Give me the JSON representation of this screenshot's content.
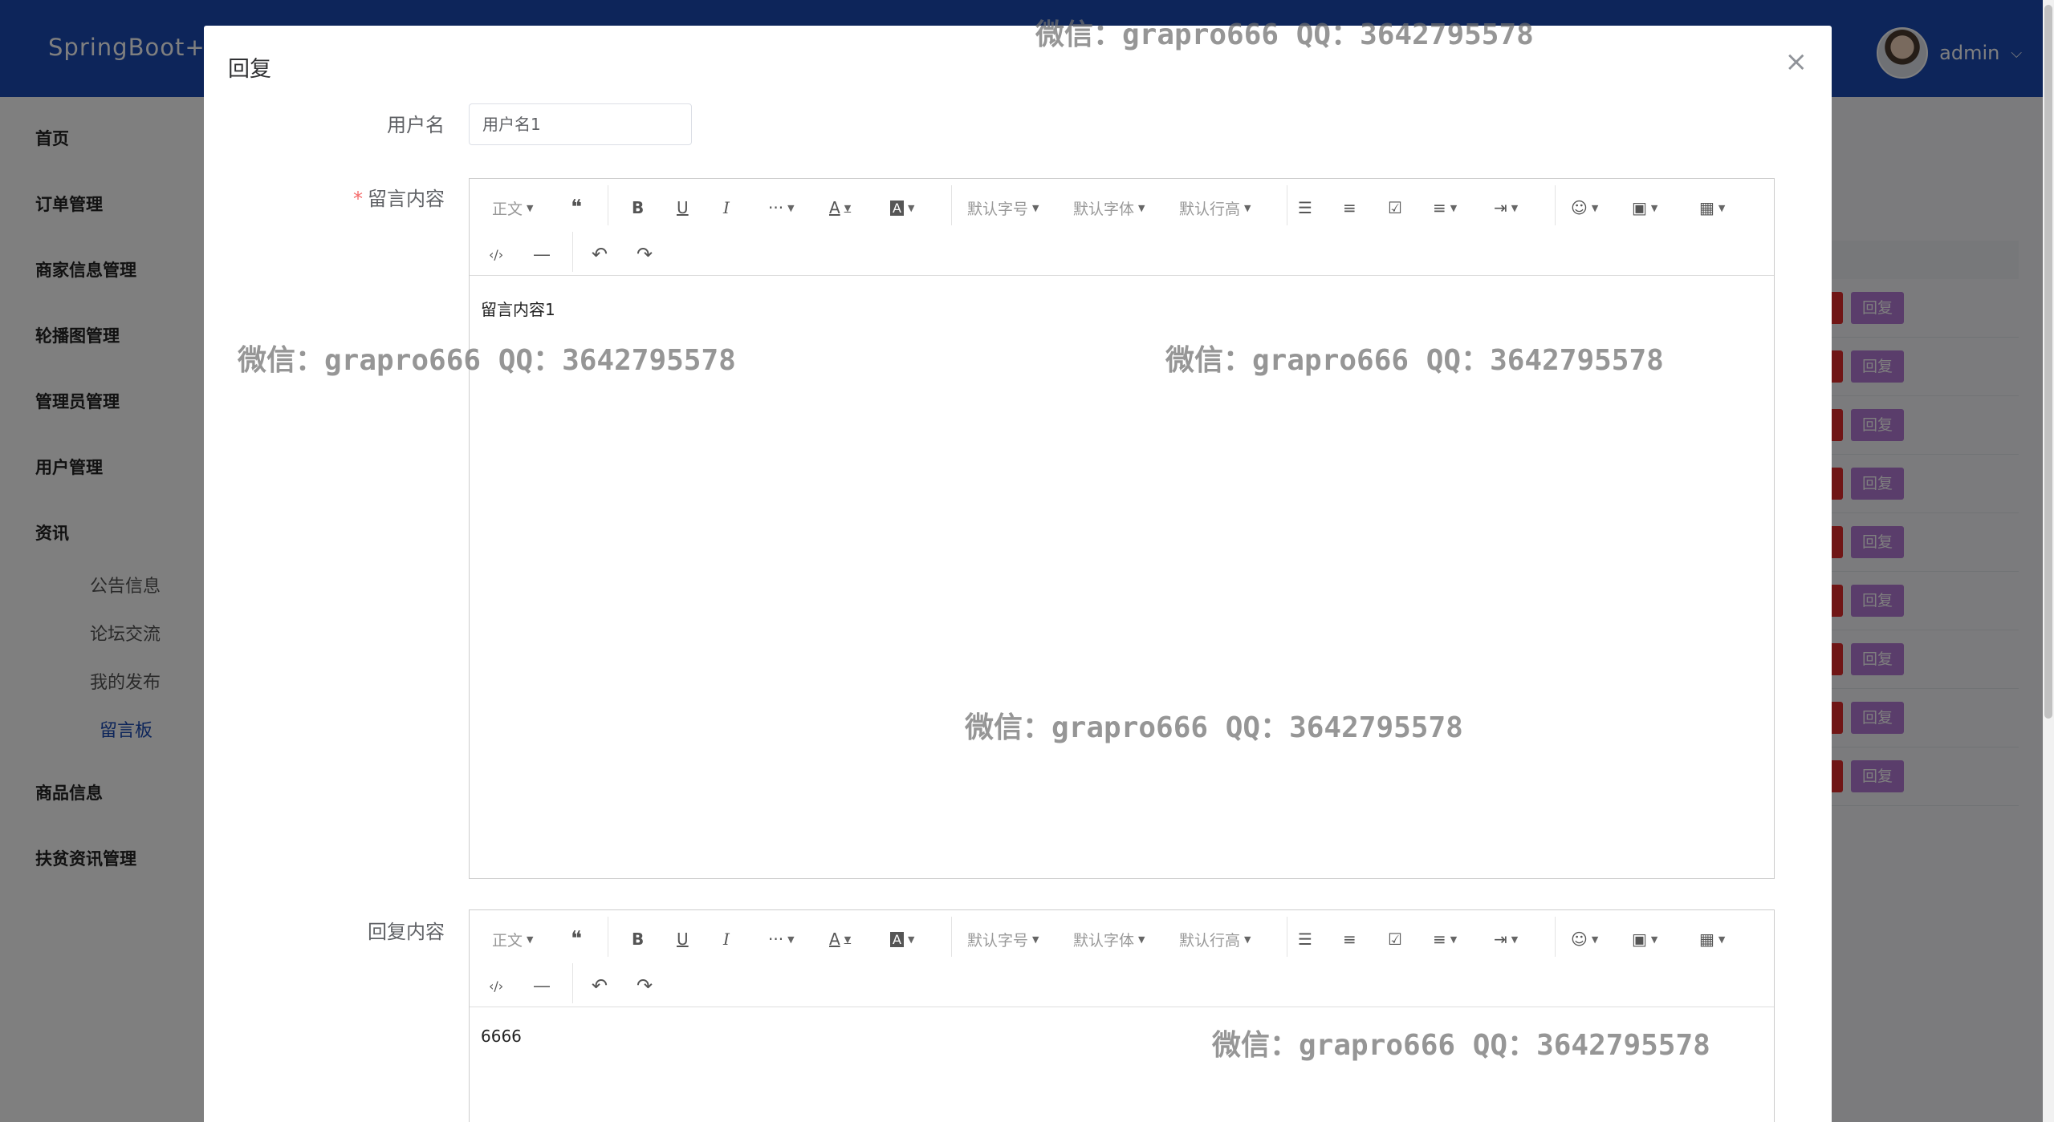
{
  "app": {
    "brand": "SpringBoot+V",
    "user": "admin"
  },
  "sidebar": {
    "items": [
      "首页",
      "订单管理",
      "商家信息管理",
      "轮播图管理",
      "管理员管理",
      "用户管理",
      "资讯",
      "商品信息",
      "扶贫资讯管理"
    ],
    "sub_items": [
      "公告信息",
      "论坛交流",
      "我的发布",
      "留言板"
    ]
  },
  "table": {
    "reply_label": "回复"
  },
  "dialog": {
    "title": "回复",
    "close_symbol": "×",
    "username_label": "用户名",
    "username_value": "用户名1",
    "required_mark": "*",
    "message_label": "留言内容",
    "message_content": "留言内容1",
    "reply_label": "回复内容",
    "reply_content": "6666"
  },
  "toolbar": {
    "paragraph": "正文",
    "quote": "❝",
    "bold": "B",
    "underline": "U",
    "italic": "I",
    "more": "···",
    "font_color": "A",
    "bg_color": "A",
    "font_size": "默认字号",
    "font_family": "默认字体",
    "line_height": "默认行高",
    "bullet_list": "☰",
    "ordered_list": "≡",
    "todo": "☑",
    "align": "≡",
    "indent": "⇥",
    "emoji": "☺",
    "image": "▣",
    "table": "▦",
    "code": "‹/›",
    "divider": "―",
    "undo": "↶",
    "redo": "↷"
  },
  "watermark": "微信：grapro666 QQ：3642795578"
}
